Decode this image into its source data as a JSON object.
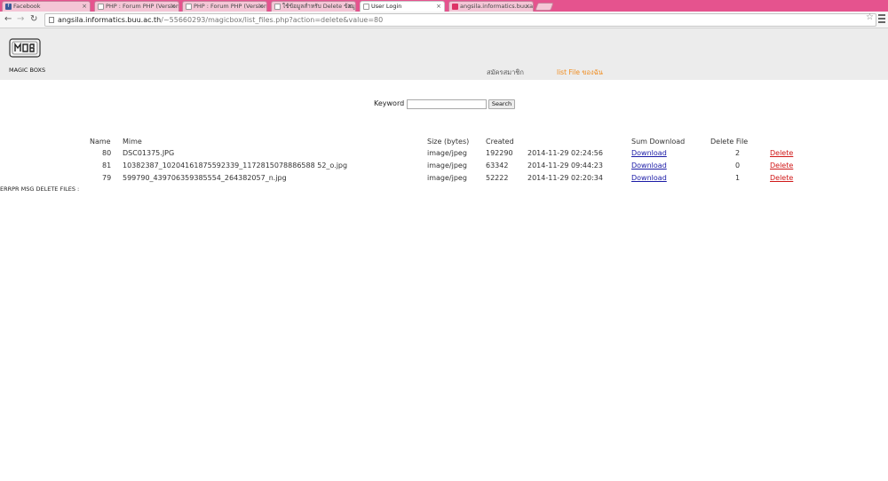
{
  "browser": {
    "tabs": [
      {
        "title": "Facebook",
        "active": false
      },
      {
        "title": "PHP : Forum PHP (Version",
        "active": false
      },
      {
        "title": "PHP : Forum PHP (Version",
        "active": false
      },
      {
        "title": "ใช้ข้อมูลสำหรับ Delete ข้อมูลที่อยู่",
        "active": false
      },
      {
        "title": "User Login",
        "active": true
      },
      {
        "title": "angsila.informatics.buu.ac",
        "active": false
      }
    ],
    "url_host": "angsila.informatics.buu.ac.th",
    "url_path": "/~55660293/magicbox/list_files.php?action=delete&value=80"
  },
  "header": {
    "logo_text": "MAGIC BOXS",
    "nav": {
      "register": "สมัครสมาชิก",
      "my_files": "list File ของฉัน"
    },
    "colors": {
      "active_nav": "#f08c1e",
      "header_bg": "#ececec"
    }
  },
  "search": {
    "label": "Keyword",
    "value": "",
    "placeholder": "",
    "button": "Search"
  },
  "table": {
    "headers": {
      "name": "Name",
      "mime": "Mime",
      "size": "Size (bytes)",
      "created": "Created",
      "sum_download": "Sum Download",
      "delete_file": "Delete File"
    },
    "rows": [
      {
        "id": "80",
        "filename": "DSC01375.JPG",
        "mime": "image/jpeg",
        "size": "192290",
        "created": "2014-11-29 02:24:56",
        "download": "Download",
        "delete_count": "2",
        "delete": "Delete"
      },
      {
        "id": "81",
        "filename": "10382387_10204161875592339_1172815078886588 52_o.jpg",
        "mime": "image/jpeg",
        "size": "63342",
        "created": "2014-11-29 09:44:23",
        "download": "Download",
        "delete_count": "0",
        "delete": "Delete"
      },
      {
        "id": "79",
        "filename": "599790_439706359385554_264382057_n.jpg",
        "mime": "image/jpeg",
        "size": "52222",
        "created": "2014-11-29 02:20:34",
        "download": "Download",
        "delete_count": "1",
        "delete": "Delete"
      }
    ]
  },
  "error_message": "ERRPR MSG DELETE FILES :"
}
